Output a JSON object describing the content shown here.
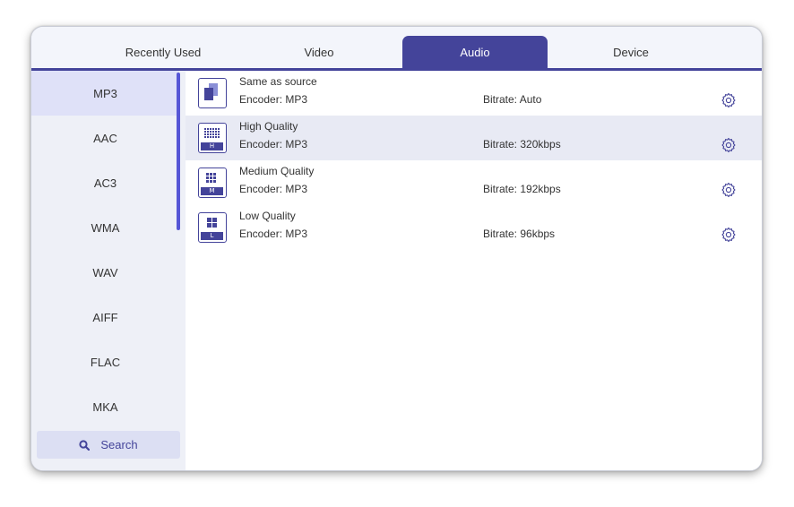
{
  "tabs": [
    {
      "label": "Recently Used"
    },
    {
      "label": "Video"
    },
    {
      "label": "Audio"
    },
    {
      "label": "Device"
    }
  ],
  "active_tab": "Audio",
  "sidebar": {
    "items": [
      {
        "label": "MP3"
      },
      {
        "label": "AAC"
      },
      {
        "label": "AC3"
      },
      {
        "label": "WMA"
      },
      {
        "label": "WAV"
      },
      {
        "label": "AIFF"
      },
      {
        "label": "FLAC"
      },
      {
        "label": "MKA"
      }
    ],
    "selected": "MP3",
    "search_label": "Search"
  },
  "presets": [
    {
      "name": "Same as source",
      "encoder": "Encoder: MP3",
      "bitrate": "Bitrate: Auto",
      "badge": "",
      "icon": "copy-icon"
    },
    {
      "name": "High Quality",
      "encoder": "Encoder: MP3",
      "bitrate": "Bitrate: 320kbps",
      "badge": "H",
      "icon": "high-quality-icon"
    },
    {
      "name": "Medium Quality",
      "encoder": "Encoder: MP3",
      "bitrate": "Bitrate: 192kbps",
      "badge": "M",
      "icon": "medium-quality-icon"
    },
    {
      "name": "Low Quality",
      "encoder": "Encoder: MP3",
      "bitrate": "Bitrate: 96kbps",
      "badge": "L",
      "icon": "low-quality-icon"
    }
  ],
  "selected_preset": "High Quality",
  "colors": {
    "accent": "#44449a",
    "sidebar_bg": "#eef0f7",
    "selected_row": "#e8eaf4",
    "scrollbar": "#5656d6"
  }
}
